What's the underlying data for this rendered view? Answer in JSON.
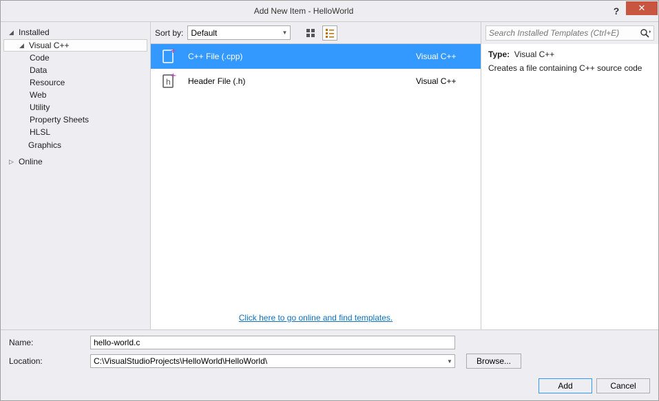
{
  "title": "Add New Item - HelloWorld",
  "sidebar": {
    "installed": "Installed",
    "visual_cpp": "Visual C++",
    "children": [
      "Code",
      "Data",
      "Resource",
      "Web",
      "Utility",
      "Property Sheets",
      "HLSL"
    ],
    "graphics": "Graphics",
    "online": "Online"
  },
  "toolbar": {
    "sort_label": "Sort by:",
    "sort_value": "Default"
  },
  "search": {
    "placeholder": "Search Installed Templates (Ctrl+E)"
  },
  "templates": [
    {
      "label": "C++ File (.cpp)",
      "lang": "Visual C++",
      "selected": true
    },
    {
      "label": "Header File (.h)",
      "lang": "Visual C++",
      "selected": false
    }
  ],
  "online_link": "Click here to go online and find templates.",
  "details": {
    "type_label": "Type:",
    "type_value": "Visual C++",
    "description": "Creates a file containing C++ source code"
  },
  "form": {
    "name_label": "Name:",
    "name_value": "hello-world.c",
    "location_label": "Location:",
    "location_value": "C:\\VisualStudioProjects\\HelloWorld\\HelloWorld\\",
    "browse": "Browse..."
  },
  "buttons": {
    "add": "Add",
    "cancel": "Cancel"
  }
}
